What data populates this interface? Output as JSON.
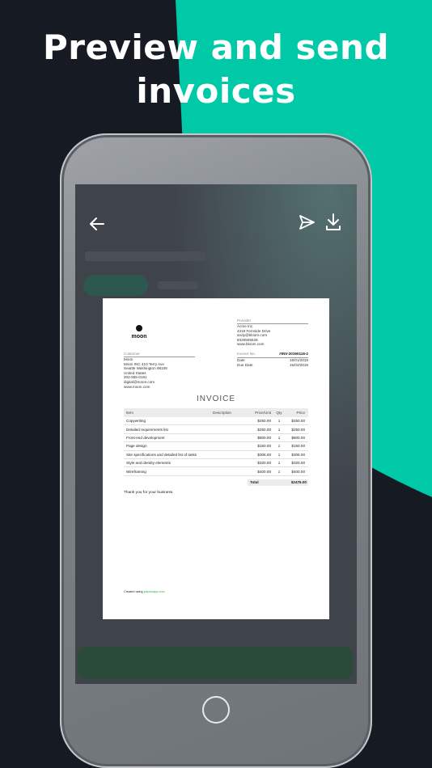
{
  "headline": {
    "line1": "Preview and send",
    "line2": "invoices"
  },
  "colors": {
    "background": "#151a23",
    "accent": "#00c9a7",
    "link": "#2ab34a"
  },
  "toolbar": {
    "back_icon": "arrow-left-icon",
    "send_icon": "send-icon",
    "download_icon": "download-icon"
  },
  "invoice": {
    "logo_text": "moon",
    "provider": {
      "label": "Provider",
      "lines": [
        "Acme Inc.",
        "4318 Fernside Drive",
        "andy@bloom.com",
        "8329505528",
        "www.bloom.com"
      ]
    },
    "customer": {
      "label": "Customer",
      "lines": [
        "Moon",
        "Moon INC 410 Terry Ave",
        "Seattle Washington 98109",
        "United States",
        "202-555-0181",
        "digital@moon.com",
        "www.moon.com"
      ]
    },
    "meta": {
      "invoice_no_label": "Invoice No.",
      "invoice_no": "#INV-20190116-2",
      "date_label": "Date",
      "date": "16/01/2019",
      "due_label": "Due Date",
      "due": "15/02/2019"
    },
    "title": "INVOICE",
    "columns": {
      "item": "Item",
      "description": "Description",
      "price_unit": "Price/Unit",
      "qty": "Qty",
      "price": "Price"
    },
    "rows": [
      {
        "item": "Copywriting",
        "price_unit": "$250.00",
        "qty": "1",
        "price": "$250.00"
      },
      {
        "item": "Detailed requirements list",
        "price_unit": "$250.00",
        "qty": "1",
        "price": "$250.00"
      },
      {
        "item": "Front-end development",
        "price_unit": "$800.00",
        "qty": "1",
        "price": "$800.00"
      },
      {
        "item": "Page design",
        "price_unit": "$150.00",
        "qty": "1",
        "price": "$150.00"
      },
      {
        "item": "Site specifications and detailed list of tasks",
        "price_unit": "$306.00",
        "qty": "1",
        "price": "$306.00"
      },
      {
        "item": "Style and identity elements",
        "price_unit": "$320.00",
        "qty": "1",
        "price": "$320.00"
      },
      {
        "item": "Wireframing",
        "price_unit": "$400.00",
        "qty": "1",
        "price": "$400.00"
      }
    ],
    "total_label": "Total",
    "total_value": "$2476.00",
    "thanks": "Thank you for your business.",
    "created_prefix": "Created using",
    "created_link": "paymoapp.com"
  }
}
